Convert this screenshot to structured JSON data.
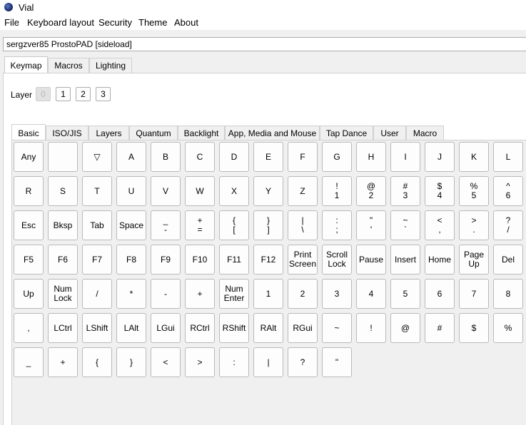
{
  "window": {
    "title": "Vial"
  },
  "menu": [
    "File",
    "Keyboard layout",
    "Security",
    "Theme",
    "About"
  ],
  "device": {
    "selected": "sergzver85 ProstoPAD [sideload]"
  },
  "main_tabs": [
    "Keymap",
    "Macros",
    "Lighting"
  ],
  "layer": {
    "label": "Layer",
    "buttons": [
      "0",
      "1",
      "2",
      "3"
    ],
    "active_index": 0
  },
  "sub_tabs": [
    "Basic",
    "ISO/JIS",
    "Layers",
    "Quantum",
    "Backlight",
    "App, Media and Mouse",
    "Tap Dance",
    "User",
    "Macro"
  ],
  "keys": [
    [
      "Any",
      "",
      "▽",
      "A",
      "B",
      "C",
      "D",
      "E",
      "F",
      "G",
      "H",
      "I",
      "J",
      "K",
      "L"
    ],
    [
      "R",
      "S",
      "T",
      "U",
      "V",
      "W",
      "X",
      "Y",
      "Z",
      "!\n1",
      "@\n2",
      "#\n3",
      "$\n4",
      "%\n5",
      "^\n6"
    ],
    [
      "Esc",
      "Bksp",
      "Tab",
      "Space",
      "_\n-",
      "+\n=",
      "{\n[",
      "}\n]",
      "|\n\\",
      ":\n;",
      "\"\n'",
      "~\n`",
      "<\n,",
      ">\n.",
      "?\n/"
    ],
    [
      "F5",
      "F6",
      "F7",
      "F8",
      "F9",
      "F10",
      "F11",
      "F12",
      "Print\nScreen",
      "Scroll\nLock",
      "Pause",
      "Insert",
      "Home",
      "Page\nUp",
      "Del"
    ],
    [
      "Up",
      "Num\nLock",
      "/",
      "*",
      "-",
      "+",
      "Num\nEnter",
      "1",
      "2",
      "3",
      "4",
      "5",
      "6",
      "7",
      "8"
    ],
    [
      ",",
      "LCtrl",
      "LShift",
      "LAlt",
      "LGui",
      "RCtrl",
      "RShift",
      "RAlt",
      "RGui",
      "~",
      "!",
      "@",
      "#",
      "$",
      "%"
    ],
    [
      "_",
      "+",
      "{",
      "}",
      "<",
      ">",
      ":",
      "|",
      "?",
      "\""
    ]
  ]
}
